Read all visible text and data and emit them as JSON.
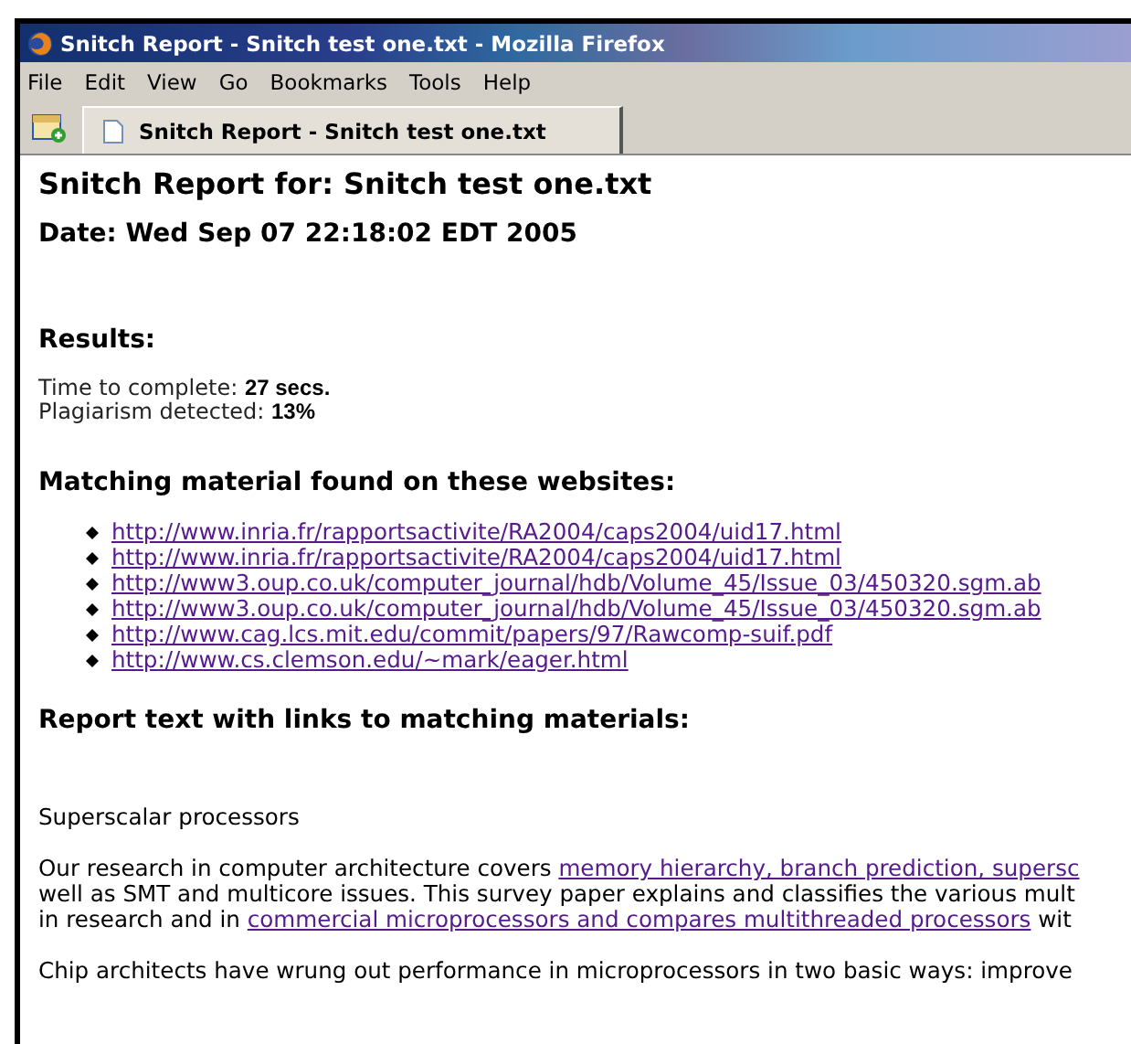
{
  "window": {
    "title": "Snitch Report - Snitch test one.txt - Mozilla Firefox"
  },
  "menu": [
    "File",
    "Edit",
    "View",
    "Go",
    "Bookmarks",
    "Tools",
    "Help"
  ],
  "tabs": [
    {
      "label": "Snitch Report - Snitch test one.txt",
      "selected": true
    }
  ],
  "page": {
    "heading": "Snitch Report for: Snitch test one.txt",
    "date": "Date: Wed Sep 07 22:18:02 EDT 2005",
    "results_heading": "Results:",
    "results": [
      {
        "label": "Time to complete: ",
        "value": "27 secs."
      },
      {
        "label": "Plagiarism detected: ",
        "value": "13%"
      }
    ],
    "matches_heading": "Matching material found on these websites:",
    "links": [
      "http://www.inria.fr/rapportsactivite/RA2004/caps2004/uid17.html",
      "http://www.inria.fr/rapportsactivite/RA2004/caps2004/uid17.html",
      "http://www3.oup.co.uk/computer_journal/hdb/Volume_45/Issue_03/450320.sgm.ab",
      "http://www3.oup.co.uk/computer_journal/hdb/Volume_45/Issue_03/450320.sgm.ab",
      "http://www.cag.lcs.mit.edu/commit/papers/97/Rawcomp-suif.pdf",
      "http://www.cs.clemson.edu/~mark/eager.html"
    ],
    "report_heading": "Report text with links to matching materials:",
    "report": [
      {
        "lines": [
          [
            {
              "text": "Superscalar processors"
            }
          ]
        ]
      },
      {
        "lines": [
          [
            {
              "text": "Our research in computer architecture covers "
            },
            {
              "text": "memory hierarchy, branch prediction, supersc",
              "link": true
            }
          ],
          [
            {
              "text": "well as SMT and multicore issues. This survey paper explains and classifies the various mult"
            }
          ],
          [
            {
              "text": "in research and in "
            },
            {
              "text": "commercial microprocessors and compares multithreaded processors",
              "link": true
            },
            {
              "text": " wit"
            }
          ]
        ]
      },
      {
        "lines": [
          [
            {
              "text": "Chip architects have wrung out performance in microprocessors in two basic ways: improve"
            }
          ]
        ]
      }
    ]
  }
}
